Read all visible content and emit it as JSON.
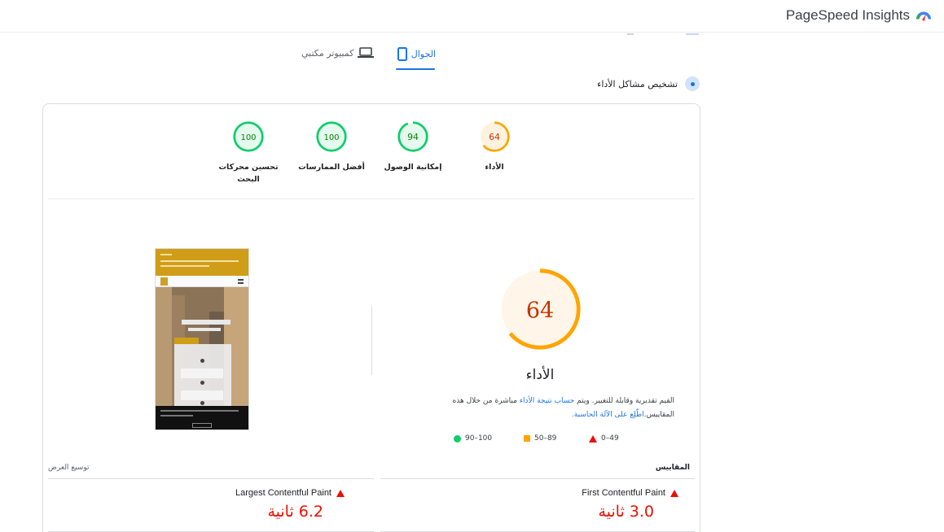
{
  "header": {
    "app_title": "PageSpeed Insights",
    "logo_icon": "pagespeed-logo-icon"
  },
  "tabs": [
    {
      "label": "الجوال",
      "icon": "mobile-phone-icon",
      "active": true
    },
    {
      "label": "كمبيوتر مكتبي",
      "icon": "laptop-icon",
      "active": false
    }
  ],
  "diagnose": {
    "label": "تشخيص مشاكل الأداء"
  },
  "categories": [
    {
      "score": "64",
      "label": "الأداء",
      "status": "average",
      "fraction": 0.64,
      "color": "#ffa400"
    },
    {
      "score": "94",
      "label": "إمكانية الوصول",
      "status": "good",
      "fraction": 0.94,
      "color": "#0cce6b"
    },
    {
      "score": "100",
      "label": "أفضل الممارسات",
      "status": "good",
      "fraction": 1.0,
      "color": "#0cce6b"
    },
    {
      "score": "100",
      "label": "تحسين محركات البحث",
      "status": "good",
      "fraction": 1.0,
      "color": "#0cce6b"
    }
  ],
  "performance": {
    "score": "64",
    "fraction": 0.64,
    "title": "الأداء",
    "desc_part1": "القيم تقديرية وقابلة للتغيير. ويتم ",
    "desc_link1": "حساب نتيجة الأداء",
    "desc_part2": " مباشرة من خلال هذه المقاييس.",
    "desc_link2": "اطّلِع على الآلة الحاسبة."
  },
  "legend": {
    "bad": "0–49",
    "average": "50–89",
    "good": "90–100"
  },
  "expand_view": "توسيع العرض",
  "metrics_heading": "المقاييس",
  "metrics": [
    {
      "name": "First Contentful Paint",
      "value": "3.0 ثانية",
      "status": "bad"
    },
    {
      "name": "Largest Contentful Paint",
      "value": "6.2 ثانية",
      "status": "bad"
    }
  ],
  "colors": {
    "accent": "#1a73e8",
    "good": "#0cce6b",
    "average": "#ffa400",
    "bad": "#eb0f00"
  }
}
